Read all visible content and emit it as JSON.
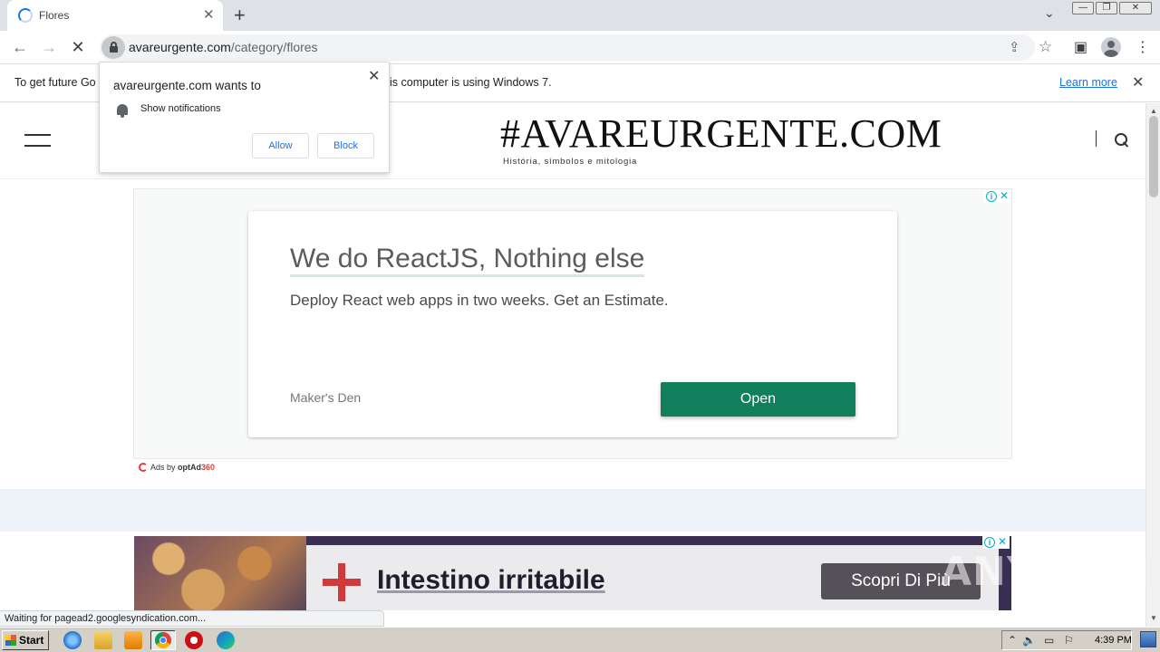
{
  "browser": {
    "tab": {
      "title": "Flores",
      "close": "✕"
    },
    "new_tab": "+",
    "tab_search": "⌄",
    "window_controls": [
      "—",
      "❐",
      "✕"
    ],
    "nav": {
      "back": "←",
      "forward": "→",
      "stop": "✕"
    },
    "url": {
      "host": "avareurgente.com",
      "path": "/category/flores"
    },
    "omni_icons": {
      "share": "⇪",
      "bookmark": "☆"
    },
    "toolbar_icons": {
      "side_panel": "▣",
      "menu": "⋮"
    }
  },
  "infobar": {
    "text_left": "To get future Go",
    "text_right": "is computer is using Windows 7.",
    "learn_more": "Learn more",
    "close": "✕"
  },
  "notification_prompt": {
    "title": "avareurgente.com wants to",
    "permission": "Show notifications",
    "allow": "Allow",
    "block": "Block",
    "close": "✕"
  },
  "site": {
    "logo": "#AVAREURGENTE.COM",
    "tagline": "História, símbolos e mitologia"
  },
  "ad1": {
    "headline": "We do ReactJS, Nothing else",
    "description": "Deploy React web apps in two weeks. Get an Estimate.",
    "brand": "Maker's Den",
    "cta": "Open",
    "adchoices_i": "i",
    "adchoices_x": "✕",
    "ads_by_prefix": "Ads by ",
    "ads_by_brand": "optAd",
    "ads_by_num": "360"
  },
  "ad2": {
    "title": "Intestino irritabile",
    "cta": "Scopri Di Più",
    "adchoices_i": "i",
    "adchoices_x": "✕"
  },
  "status_bubble": "Waiting for pagead2.googlesyndication.com...",
  "watermark": "ANY RUN",
  "taskbar": {
    "start": "Start",
    "clock": "4:39 PM",
    "tray_icons": [
      "⌃",
      "🔈",
      "▭",
      "⚐"
    ]
  },
  "colors": {
    "ad_cta": "#117f5c",
    "link": "#1a73e8",
    "ad2_accent": "#d03a3a"
  }
}
